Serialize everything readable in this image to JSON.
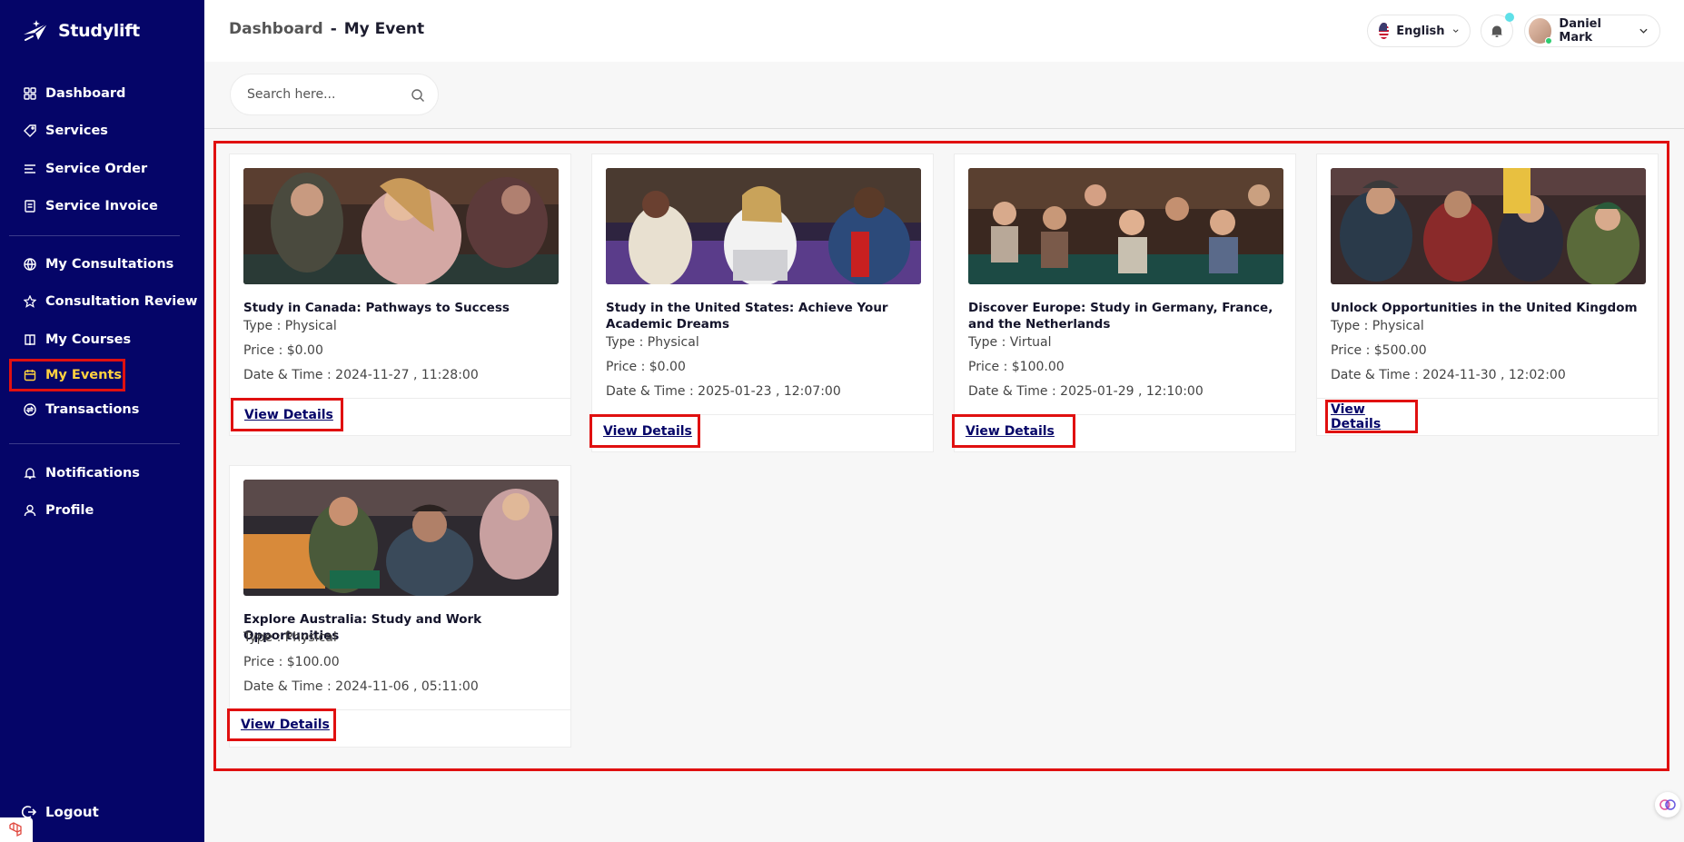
{
  "brand": {
    "name": "Studylift"
  },
  "sidebar": {
    "group1": [
      {
        "label": "Dashboard",
        "icon": "grid-icon"
      },
      {
        "label": "Services",
        "icon": "tag-icon"
      },
      {
        "label": "Service Order",
        "icon": "list-icon"
      },
      {
        "label": "Service Invoice",
        "icon": "invoice-icon"
      }
    ],
    "group2": [
      {
        "label": "My Consultations",
        "icon": "globe-icon"
      },
      {
        "label": "Consultation Review",
        "icon": "star-icon"
      },
      {
        "label": "My Courses",
        "icon": "book-icon"
      },
      {
        "label": "My Events",
        "icon": "calendar-icon",
        "active": true
      },
      {
        "label": "Transactions",
        "icon": "transactions-icon"
      }
    ],
    "group3": [
      {
        "label": "Notifications",
        "icon": "bell-icon"
      },
      {
        "label": "Profile",
        "icon": "user-icon"
      }
    ],
    "logout_label": "Logout"
  },
  "header": {
    "breadcrumb_root": "Dashboard",
    "breadcrumb_sep": "-",
    "breadcrumb_current": "My Event",
    "language": "English",
    "user_name": "Daniel Mark"
  },
  "search": {
    "placeholder": "Search here..."
  },
  "colors": {
    "sidebar_bg": "#050568",
    "active_text": "#ffd23f",
    "highlight": "#e01010",
    "accent": "#050568"
  },
  "events": [
    {
      "title": "Study in Canada: Pathways to Success",
      "type": "Type : Physical",
      "price": "Price : $0.00",
      "datetime": "Date & Time : 2024-11-27 , 11:28:00",
      "action": "View Details"
    },
    {
      "title": "Study in the United States: Achieve Your Academic Dreams",
      "type": "Type : Physical",
      "price": "Price : $0.00",
      "datetime": "Date & Time : 2025-01-23 , 12:07:00",
      "action": "View Details"
    },
    {
      "title": "Discover Europe: Study in Germany, France, and the Netherlands",
      "type": "Type : Virtual",
      "price": "Price : $100.00",
      "datetime": "Date & Time : 2025-01-29 , 12:10:00",
      "action": "View Details"
    },
    {
      "title": "Unlock Opportunities in the United Kingdom",
      "type": "Type : Physical",
      "price": "Price : $500.00",
      "datetime": "Date & Time : 2024-11-30 , 12:02:00",
      "action": "View Details"
    },
    {
      "title": "Explore Australia: Study and Work Opportunities",
      "type": "Type : Physical",
      "price": "Price : $100.00",
      "datetime": "Date & Time : 2024-11-06 , 05:11:00",
      "action": "View Details"
    }
  ]
}
